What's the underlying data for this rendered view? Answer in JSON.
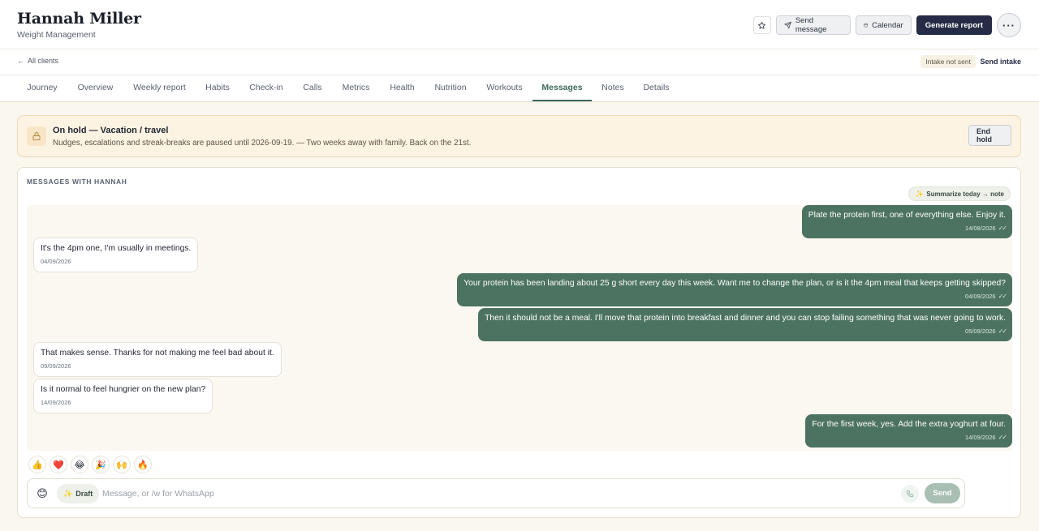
{
  "header": {
    "client_name": "Hannah Miller",
    "program": "Weight Management",
    "actions": {
      "send_message": "Send message",
      "calendar": "Calendar",
      "generate_report": "Generate report",
      "more": "···"
    }
  },
  "subbar": {
    "back_label": "All clients",
    "intake_status": "Intake not sent",
    "send_intake": "Send intake"
  },
  "tabs": [
    {
      "label": "Journey"
    },
    {
      "label": "Overview"
    },
    {
      "label": "Weekly report"
    },
    {
      "label": "Habits"
    },
    {
      "label": "Check-in"
    },
    {
      "label": "Calls"
    },
    {
      "label": "Metrics"
    },
    {
      "label": "Health"
    },
    {
      "label": "Nutrition"
    },
    {
      "label": "Workouts"
    },
    {
      "label": "Messages",
      "active": true
    },
    {
      "label": "Notes"
    },
    {
      "label": "Details"
    }
  ],
  "hold": {
    "title": "On hold — Vacation / travel",
    "description": "Nudges, escalations and streak-breaks are paused until 2026-09-19. — Two weeks away with family. Back on the 21st.",
    "end_label": "End hold"
  },
  "messages": {
    "heading": "MESSAGES WITH HANNAH",
    "summarize_label": "Summarize today → note",
    "thread": [
      {
        "direction": "out",
        "text": "Plate the protein first, one of everything else. Enjoy it.",
        "date": "14/08/2026"
      },
      {
        "direction": "in",
        "text": "It's the 4pm one, I'm usually in meetings.",
        "date": "04/09/2026"
      },
      {
        "direction": "out",
        "text": "Your protein has been landing about 25 g short every day this week. Want me to change the plan, or is it the 4pm meal that keeps getting skipped?",
        "date": "04/09/2026"
      },
      {
        "direction": "out",
        "text": "Then it should not be a meal. I'll move that protein into breakfast and dinner and you can stop failing something that was never going to work.",
        "date": "05/09/2026"
      },
      {
        "direction": "in",
        "text": "That makes sense. Thanks for not making me feel bad about it.",
        "date": "09/09/2026"
      },
      {
        "direction": "in",
        "text": "Is it normal to feel hungrier on the new plan?",
        "date": "14/09/2026"
      },
      {
        "direction": "out",
        "text": "For the first week, yes. Add the extra yoghurt at four.",
        "date": "14/09/2026"
      }
    ],
    "reactions": [
      {
        "emoji": "👍",
        "name": "thumbs-up"
      },
      {
        "emoji": "❤️",
        "name": "heart"
      },
      {
        "emoji": "😂",
        "name": "laughing"
      },
      {
        "emoji": "🎉",
        "name": "party"
      },
      {
        "emoji": "🙌",
        "name": "raised-hands"
      },
      {
        "emoji": "🔥",
        "name": "fire"
      }
    ]
  },
  "composer": {
    "emoji": "😊",
    "draft_label": "Draft",
    "placeholder": "Message, or /w for WhatsApp",
    "value": "",
    "send_label": "Send"
  },
  "colors": {
    "accent": "#3d6a59",
    "outgoing_bubble": "#4c7361",
    "primary_button": "#262c45",
    "hold_banner": "#fdf3e3"
  }
}
